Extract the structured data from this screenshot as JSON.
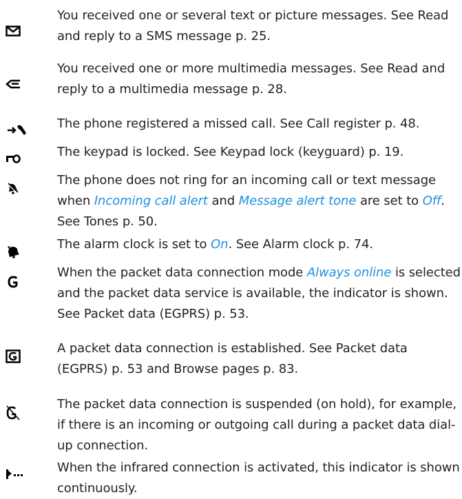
{
  "entries": [
    {
      "icon": "envelope-icon",
      "text": "You received one or several text or picture messages. See Read and reply to a SMS message p. 25."
    },
    {
      "icon": "multimedia-message-icon",
      "text": "You received one or more multimedia messages. See Read and reply to a multimedia message p. 28."
    },
    {
      "icon": "missed-call-icon",
      "text": "The phone registered a missed call. See Call register p. 48."
    },
    {
      "icon": "key-lock-icon",
      "text": "The keypad is locked. See Keypad lock (keyguard) p. 19."
    },
    {
      "icon": "silent-mode-icon",
      "parts": [
        "The phone does not ring for an incoming call or text message when ",
        "Incoming call alert",
        " and ",
        "Message alert tone",
        " are set to ",
        "Off",
        ". See Tones p. 50."
      ]
    },
    {
      "icon": "alarm-clock-icon",
      "parts": [
        "The alarm clock is set to ",
        "On",
        ". See Alarm clock p. 74."
      ]
    },
    {
      "icon": "gprs-always-online-icon",
      "parts": [
        "When the packet data connection mode ",
        "Always online",
        " is selected and the packet data service is available, the indicator is shown. See Packet data (EGPRS) p. 53."
      ]
    },
    {
      "icon": "gprs-connection-established-icon",
      "text": "A packet data connection is established. See Packet data (EGPRS) p. 53 and Browse pages p. 83."
    },
    {
      "icon": "gprs-suspended-icon",
      "text": "The packet data connection is suspended (on hold), for example, if there is an incoming or outgoing call during a packet data dial-up connection."
    },
    {
      "icon": "infrared-icon",
      "text": "When the infrared connection is activated, this indicator is shown continuously."
    }
  ]
}
